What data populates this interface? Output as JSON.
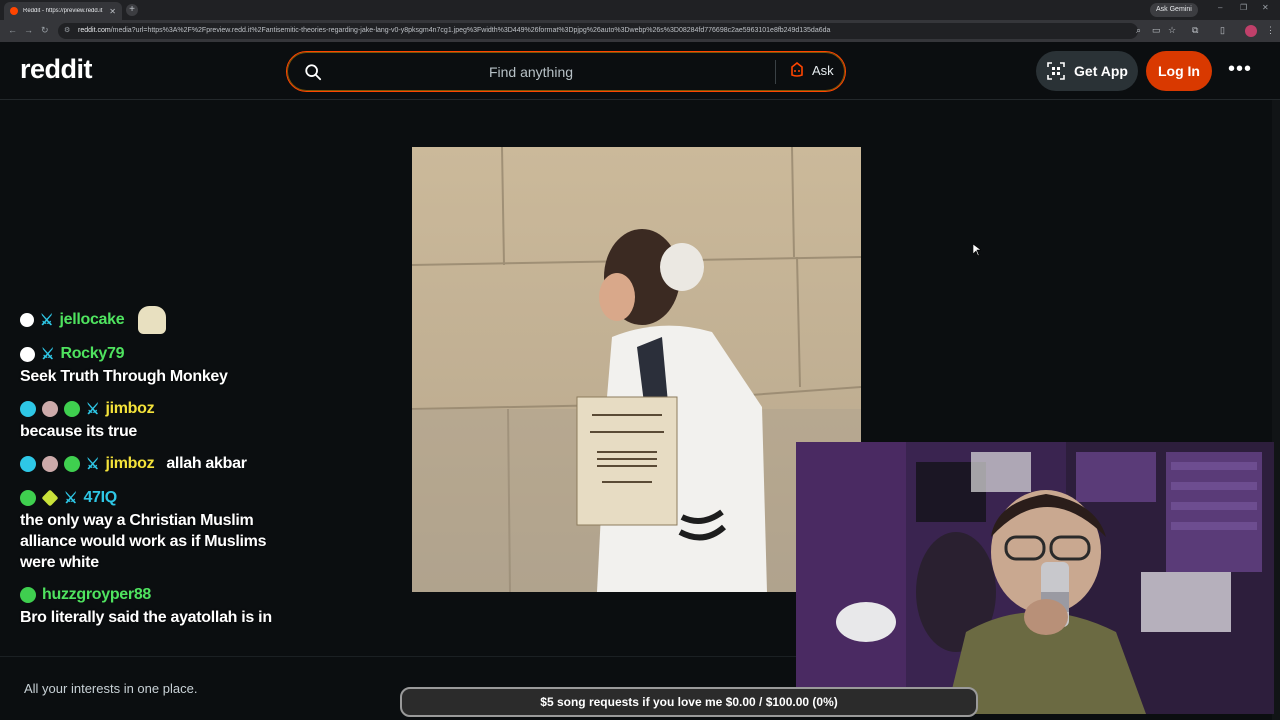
{
  "browser": {
    "tab_title": "Reddit - https://preview.redd.it",
    "new_tab": "+",
    "ask_gemini": "Ask Gemini",
    "url_host": "reddit.com",
    "url_path": "/media?url=https%3A%2F%2Fpreview.redd.it%2Fantisemitic-theories-regarding-jake-lang-v0-y8pksgm4n7cg1.jpeg%3Fwidth%3D449%26format%3Dpjpg%26auto%3Dwebp%26s%3D08284fd776698c2ae5963101e8fb249d135da6da",
    "minimize": "–",
    "restore": "❐",
    "close": "✕"
  },
  "header": {
    "logo": "reddit",
    "search_placeholder": "Find anything",
    "ask_label": "Ask",
    "get_app_label": "Get App",
    "login_label": "Log In",
    "more_label": "•••"
  },
  "chat": {
    "messages": [
      {
        "user": "jellocake",
        "user_color": "#4fe35f",
        "text": ""
      },
      {
        "user": "Rocky79",
        "user_color": "#4fe35f",
        "text": "Seek Truth Through Monkey"
      },
      {
        "user": "jimboz",
        "user_color": "#f4e23a",
        "text": "because its true"
      },
      {
        "user": "jimboz",
        "user_color": "#f4e23a",
        "text": "allah akbar"
      },
      {
        "user": "47IQ",
        "user_color": "#2ec7e6",
        "text": "the only way a Christian Muslim alliance would work as if Muslims were white"
      },
      {
        "user": "huzzgroyper88",
        "user_color": "#4fe35f",
        "text": "Bro literally said the ayatollah is in"
      }
    ]
  },
  "footer": {
    "tagline": "All your interests in one place."
  },
  "donation_bar": {
    "text": "$5 song requests if you love me $0.00 / $100.00 (0%)",
    "progress_percent": 0
  },
  "colors": {
    "brand": "#ff4500",
    "login_bg": "#d93900",
    "page_bg": "#0b0e10"
  }
}
